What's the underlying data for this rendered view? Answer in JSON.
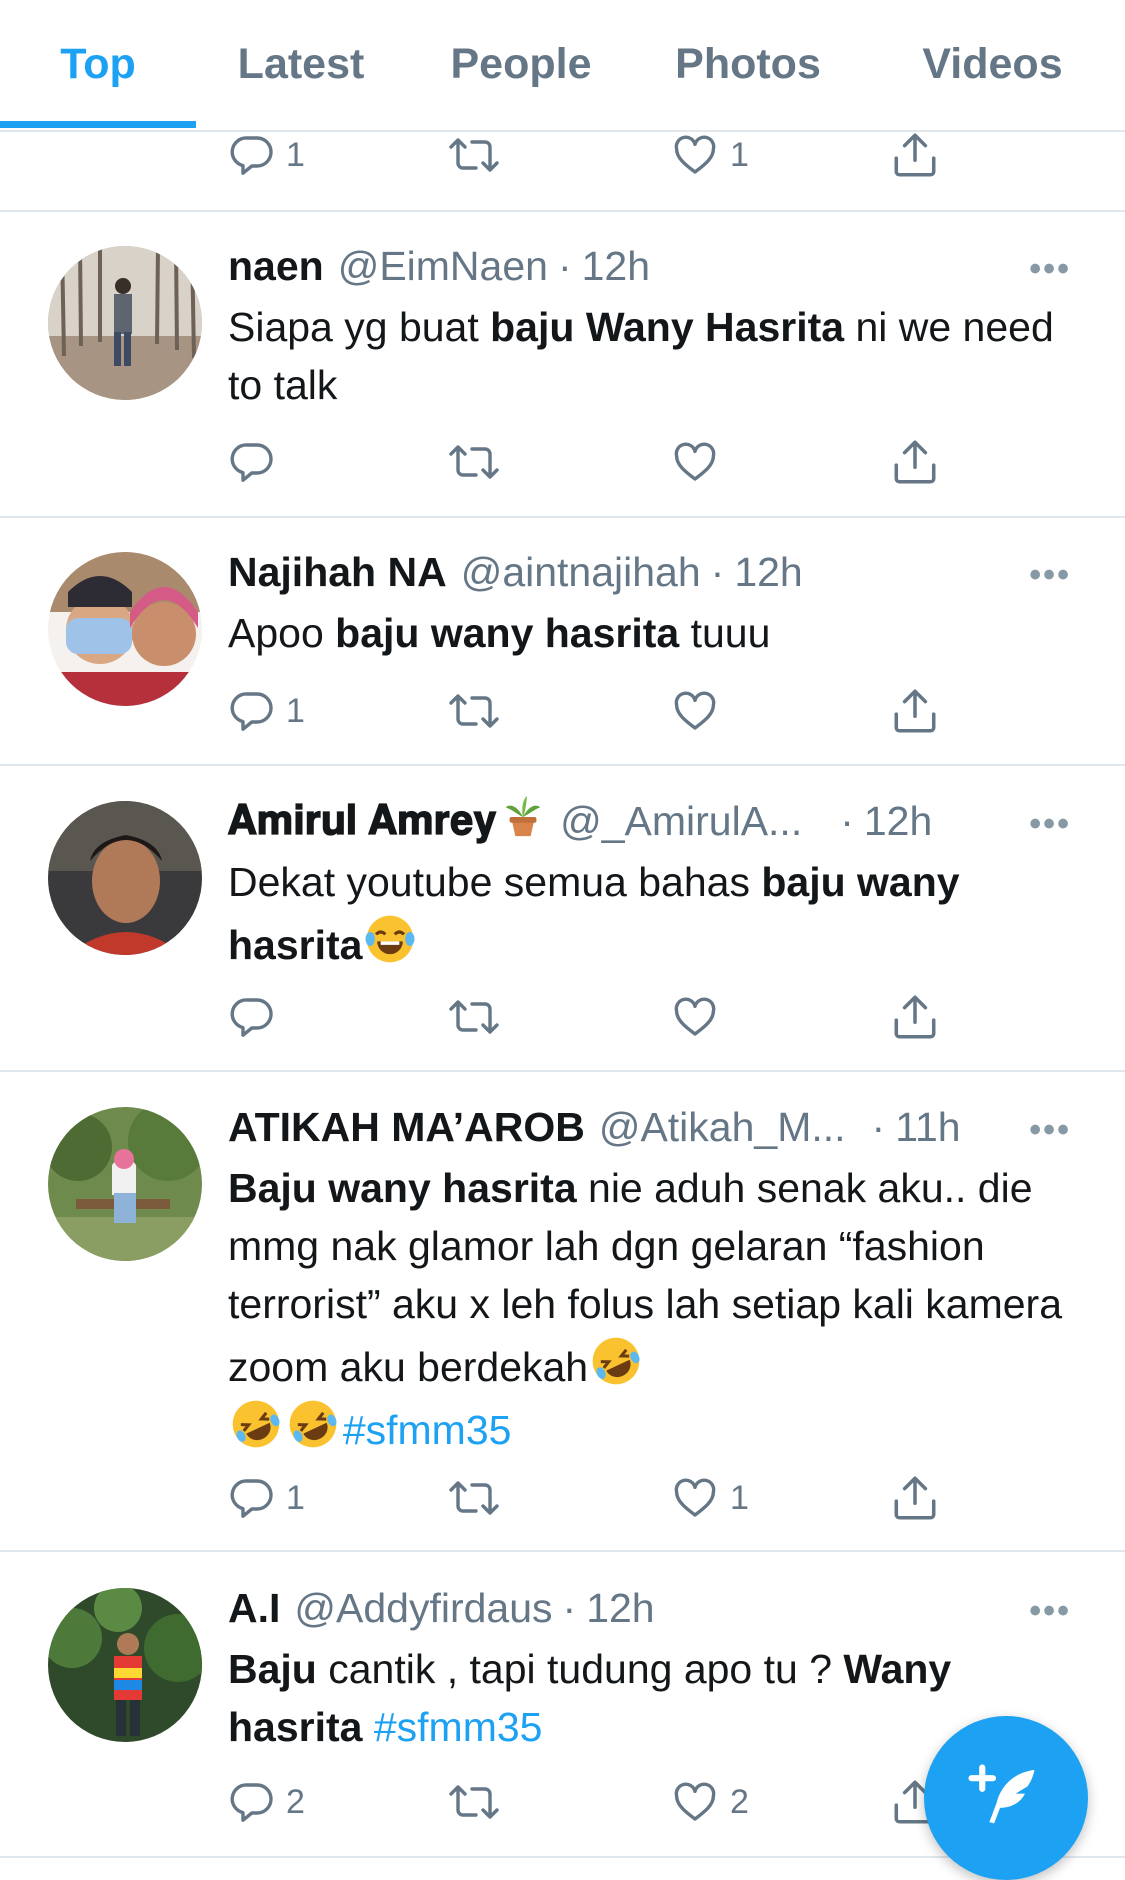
{
  "tabs": [
    {
      "label": "Top",
      "active": true
    },
    {
      "label": "Latest",
      "active": false
    },
    {
      "label": "People",
      "active": false
    },
    {
      "label": "Photos",
      "active": false
    },
    {
      "label": "Videos",
      "active": false
    }
  ],
  "top_actions": {
    "reply_count": "1",
    "retweet_count": "",
    "like_count": "1"
  },
  "tweets": [
    {
      "name": "naen",
      "handle": "@EimNaen",
      "dot": "·",
      "time": "12h",
      "text": [
        {
          "t": "Siapa yg buat "
        },
        {
          "t": "baju Wany Hasrita",
          "bold": true
        },
        {
          "t": " ni we need to talk"
        }
      ],
      "reply_count": "",
      "retweet_count": "",
      "like_count": ""
    },
    {
      "name": "Najihah NA",
      "handle": "@aintnajihah",
      "dot": "·",
      "time": "12h",
      "text": [
        {
          "t": "Apoo "
        },
        {
          "t": "baju wany hasrita",
          "bold": true
        },
        {
          "t": " tuuu"
        }
      ],
      "reply_count": "1",
      "retweet_count": "",
      "like_count": ""
    },
    {
      "name": "𝐀𝐦𝐢𝐫𝐮𝐥 𝐀𝐦𝐫𝐞𝐲",
      "name_emoji": "potted-plant",
      "handle": "@_AmirulA...",
      "dot": "·",
      "time": "12h",
      "text": [
        {
          "t": "Dekat youtube semua bahas "
        },
        {
          "t": "baju wany hasrita",
          "bold": true
        }
      ],
      "reply_count": "",
      "retweet_count": "",
      "like_count": ""
    },
    {
      "name": "ATIKAH MA’AROB",
      "handle": "@Atikah_M...",
      "dot": "·",
      "time": "11h",
      "text": [
        {
          "t": "Baju wany hasrita",
          "bold": true
        },
        {
          "t": " nie aduh senak aku.. die mmg nak glamor lah dgn gelaran “fashion terrorist” aku x leh folus lah setiap kali kamera zoom aku berdekah"
        }
      ],
      "hashtag": "#sfmm35",
      "reply_count": "1",
      "retweet_count": "",
      "like_count": "1"
    },
    {
      "name": "A.I",
      "handle": "@Addyfirdaus",
      "dot": "·",
      "time": "12h",
      "text": [
        {
          "t": "Baju",
          "bold": true
        },
        {
          "t": " cantik , tapi tudung apo tu ? "
        },
        {
          "t": "Wany hasrita",
          "bold": true
        },
        {
          "t": " "
        }
      ],
      "hashtag": "#sfmm35",
      "reply_count": "2",
      "retweet_count": "",
      "like_count": "2"
    }
  ],
  "more_glyph": "•••",
  "colors": {
    "accent": "#1da1f2",
    "secondary_text": "#657786",
    "divider": "#e1e8ed"
  }
}
